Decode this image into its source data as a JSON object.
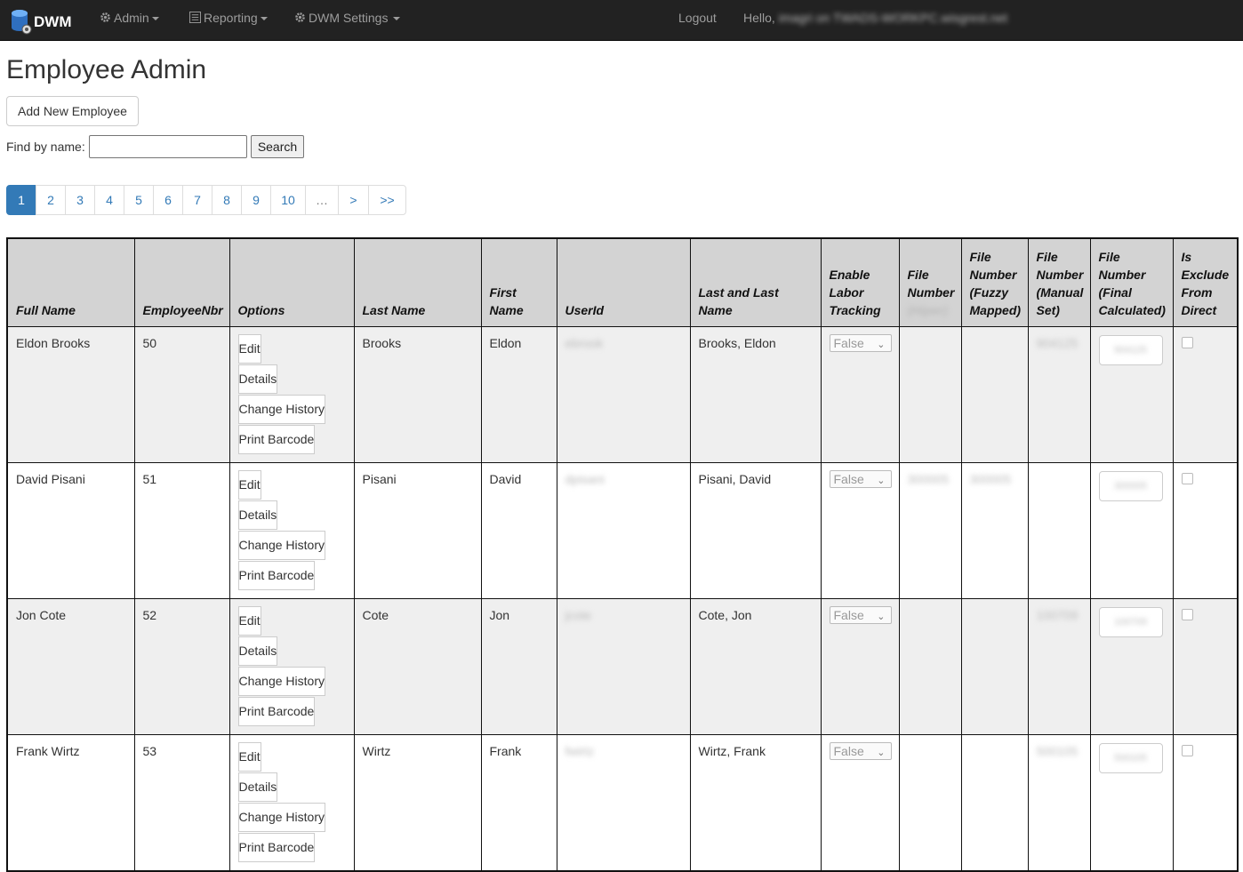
{
  "nav": {
    "brand": "DWM",
    "admin": "Admin",
    "reporting": "Reporting",
    "dwm_settings": "DWM Settings",
    "logout": "Logout",
    "hello": "Hello,",
    "user": "imagri on TWADS-WORKPC.wisgrest.net"
  },
  "page": {
    "title": "Employee Admin",
    "add_button": "Add New Employee",
    "find_label": "Find by name:",
    "search_button": "Search",
    "find_value": ""
  },
  "pagination": [
    "1",
    "2",
    "3",
    "4",
    "5",
    "6",
    "7",
    "8",
    "9",
    "10",
    "…",
    ">",
    ">>"
  ],
  "table": {
    "headers": {
      "full_name": "Full Name",
      "employee_nbr": "EmployeeNbr",
      "options": "Options",
      "last_name": "Last Name",
      "first_name": "First Name",
      "userid": "UserId",
      "last_and_last": "Last and Last Name",
      "enable_labor": "Enable Labor Tracking",
      "file_number": "File Number",
      "file_number_sub": "(Hiper)",
      "file_fuzzy": "File Number (Fuzzy Mapped)",
      "file_manual": "File Number (Manual Set)",
      "file_final": "File Number (Final Calculated)",
      "exclude": "Is Exclude From Direct"
    },
    "option_labels": {
      "edit": "Edit",
      "details": "Details",
      "history": "Change History",
      "barcode": "Print Barcode"
    },
    "rows": [
      {
        "full_name": "Eldon Brooks",
        "nbr": "50",
        "last": "Brooks",
        "first": "Eldon",
        "userid": "ebrook",
        "last_and_last": "Brooks, Eldon",
        "labor": "False",
        "file_number": "",
        "file_fuzzy": "",
        "file_manual": "904125",
        "file_final": "904125"
      },
      {
        "full_name": "David Pisani",
        "nbr": "51",
        "last": "Pisani",
        "first": "David",
        "userid": "dpisani",
        "last_and_last": "Pisani, David",
        "labor": "False",
        "file_number": "300005",
        "file_fuzzy": "300005",
        "file_manual": "",
        "file_final": "300005"
      },
      {
        "full_name": "Jon Cote",
        "nbr": "52",
        "last": "Cote",
        "first": "Jon",
        "userid": "jcote",
        "last_and_last": "Cote, Jon",
        "labor": "False",
        "file_number": "",
        "file_fuzzy": "",
        "file_manual": "100709",
        "file_final": "100709"
      },
      {
        "full_name": "Frank Wirtz",
        "nbr": "53",
        "last": "Wirtz",
        "first": "Frank",
        "userid": "fwirtz",
        "last_and_last": "Wirtz, Frank",
        "labor": "False",
        "file_number": "",
        "file_fuzzy": "",
        "file_manual": "500105",
        "file_final": "500105"
      }
    ]
  }
}
